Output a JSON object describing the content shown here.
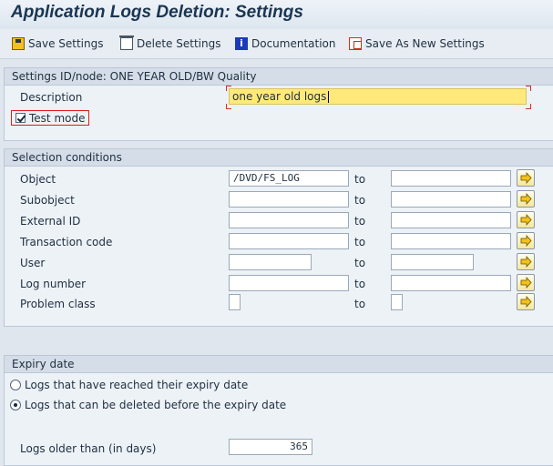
{
  "window": {
    "title": "Application Logs Deletion: Settings"
  },
  "toolbar": {
    "save_settings": "Save Settings",
    "delete_settings": "Delete Settings",
    "documentation": "Documentation",
    "save_as_new": "Save As New Settings"
  },
  "settings": {
    "header": "Settings ID/node: ONE YEAR OLD/BW Quality",
    "description_label": "Description",
    "description_value": "one year old logs",
    "test_mode_label": "Test mode",
    "test_mode_checked": true
  },
  "selection": {
    "header": "Selection conditions",
    "to_label": "to",
    "rows": [
      {
        "label": "Object",
        "from": "/DVD/FS_LOG",
        "to": ""
      },
      {
        "label": "Subobject",
        "from": "",
        "to": ""
      },
      {
        "label": "External ID",
        "from": "",
        "to": ""
      },
      {
        "label": "Transaction code",
        "from": "",
        "to": ""
      },
      {
        "label": "User",
        "from": "",
        "to": ""
      },
      {
        "label": "Log number",
        "from": "",
        "to": ""
      },
      {
        "label": "Problem class",
        "from": "",
        "to": ""
      }
    ]
  },
  "expiry": {
    "header": "Expiry date",
    "option_reached": "Logs that have reached their expiry date",
    "option_before": "Logs that can be deleted before the expiry date",
    "selected_option": "option_before",
    "older_than_label": "Logs older than (in days)",
    "older_than_value": "365"
  },
  "colors": {
    "accent_arrow": "#f2c21b",
    "highlight_field": "#ffe97a",
    "test_mode_border": "#e11a1a"
  }
}
